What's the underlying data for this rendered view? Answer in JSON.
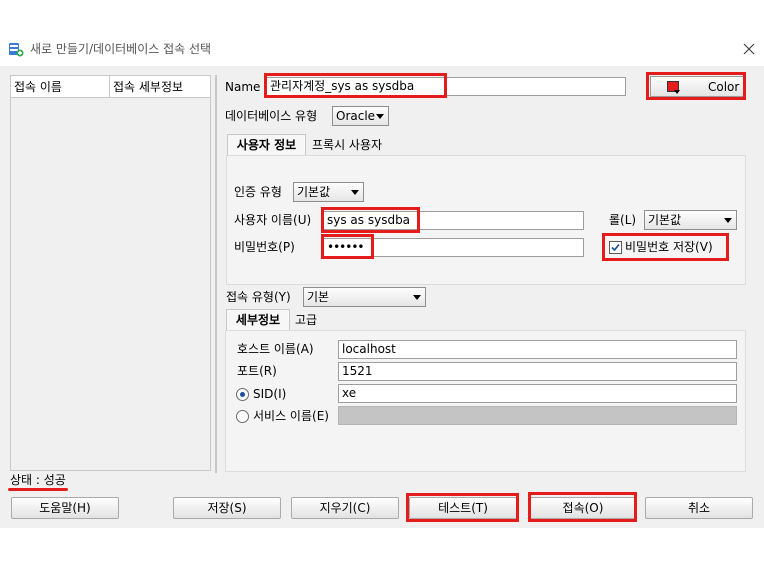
{
  "window": {
    "title": "새로 만들기/데이터베이스 접속 선택",
    "close_glyph": "✕"
  },
  "connection_list": {
    "columns": [
      "접속 이름",
      "접속 세부정보"
    ]
  },
  "form": {
    "name_label": "Name",
    "name_value": "관리자계정_sys as sysdba",
    "color_label": "Color",
    "color_swatch": "#e41c1c",
    "db_type_label": "데이터베이스 유형",
    "db_type_value": "Oracle",
    "tabs": [
      "사용자 정보",
      "프록시 사용자"
    ],
    "auth_type_label": "인증 유형",
    "auth_type_value": "기본값",
    "username_label": "사용자 이름(U)",
    "username_value": "sys as sysdba",
    "role_label": "롤(L)",
    "role_value": "기본값",
    "password_label": "비밀번호(P)",
    "password_value": "••••••",
    "save_password_label": "비밀번호 저장(V)",
    "save_password_checked": true,
    "conn_type_label": "접속 유형(Y)",
    "conn_type_value": "기본",
    "detail_tabs": [
      "세부정보",
      "고급"
    ],
    "host_label": "호스트 이름(A)",
    "host_value": "localhost",
    "port_label": "포트(R)",
    "port_value": "1521",
    "sid_label": "SID(I)",
    "sid_value": "xe",
    "service_label": "서비스 이름(E)",
    "service_value": ""
  },
  "status": {
    "text": "상태 : 성공"
  },
  "buttons": {
    "help": "도움말(H)",
    "save": "저장(S)",
    "clear": "지우기(C)",
    "test": "테스트(T)",
    "connect": "접속(O)",
    "cancel": "취소"
  },
  "colors": {
    "highlight": "#e41c1c",
    "dialog_bg": "#f0f0f0"
  }
}
